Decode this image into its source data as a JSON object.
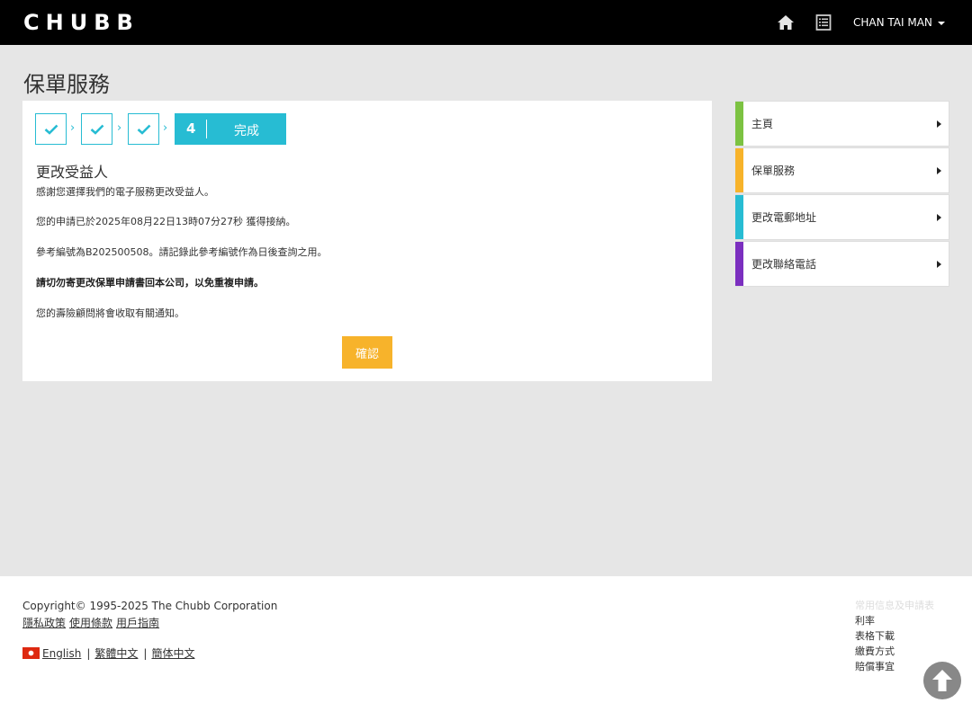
{
  "header": {
    "logo": "CHUBB",
    "icons": [
      "home-icon",
      "list-icon"
    ],
    "user_name": "CHAN TAI MAN"
  },
  "page_title": "保單服務",
  "steps": {
    "current_number": "4",
    "current_label": "完成"
  },
  "content": {
    "title": "更改受益人",
    "line1": "感謝您選擇我們的電子服務更改受益人。",
    "line2": "您的申請已於2025年08月22日13時07分27秒 獲得接納。",
    "line3": "參考編號為B202500508。請記錄此參考編號作為日後查詢之用。",
    "line4": "請切勿寄更改保單申請書回本公司，以免重複申請。",
    "line5": "您的壽險顧問將會收取有關通知。",
    "confirm_label": "確認"
  },
  "sidenav": {
    "items": [
      {
        "label": "主頁",
        "color": "#7cc242"
      },
      {
        "label": "保單服務",
        "color": "#f7b32b"
      },
      {
        "label": "更改電郵地址",
        "color": "#27bcd3"
      },
      {
        "label": "更改聯絡電話",
        "color": "#7b2fbf"
      }
    ]
  },
  "footer": {
    "copyright": "Copyright© 1995-2025 The Chubb Corporation",
    "links": [
      "隱私政策",
      "使用條款",
      "用戶指南"
    ],
    "languages": [
      "English",
      "繁體中文",
      "簡体中文"
    ],
    "right_links": [
      "常用信息及申請表",
      "利率",
      "表格下載",
      "繳費方式",
      "賠償事宜"
    ]
  }
}
